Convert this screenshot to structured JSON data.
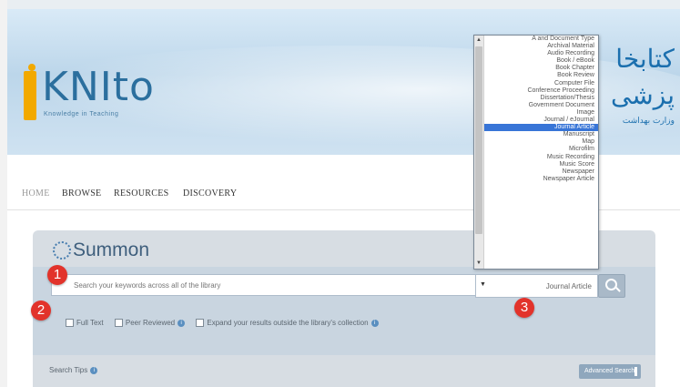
{
  "banner": {
    "logo_text": "KNIto",
    "logo_tagline": "Knowledge in Teaching",
    "persian_line1": "کتابخا",
    "persian_line2": "پزشی",
    "persian_line3": "وزارت بهداشت"
  },
  "nav": {
    "items": [
      "HOME",
      "BROWSE",
      "RESOURCES",
      "DISCOVERY"
    ]
  },
  "summon": {
    "title": "Summon",
    "search_placeholder": "Search your keywords across all of the library",
    "selected_type": "Journal Article",
    "options": {
      "full_text": "Full Text",
      "peer_reviewed": "Peer Reviewed",
      "expand": "Expand your results outside the library's collection"
    },
    "search_tips": "Search Tips",
    "advanced_search": "Advanced Search"
  },
  "dropdown": {
    "items": [
      "A and Document Type",
      "Archival Material",
      "Audio Recording",
      "Book / eBook",
      "Book Chapter",
      "Book Review",
      "Computer File",
      "Conference Proceeding",
      "Dissertation/Thesis",
      "Government Document",
      "Image",
      "Journal / eJournal",
      "Journal Article",
      "Manuscript",
      "Map",
      "Microfilm",
      "Music Recording",
      "Music Score",
      "Newspaper",
      "Newspaper Article"
    ],
    "selected_index": 12
  },
  "badges": {
    "b1": "1",
    "b2": "2",
    "b3": "3"
  },
  "colors": {
    "badge_red": "#e2332b",
    "logo_orange": "#f2a900",
    "logo_blue": "#2b6f9e",
    "selection_blue": "#3875d7"
  }
}
